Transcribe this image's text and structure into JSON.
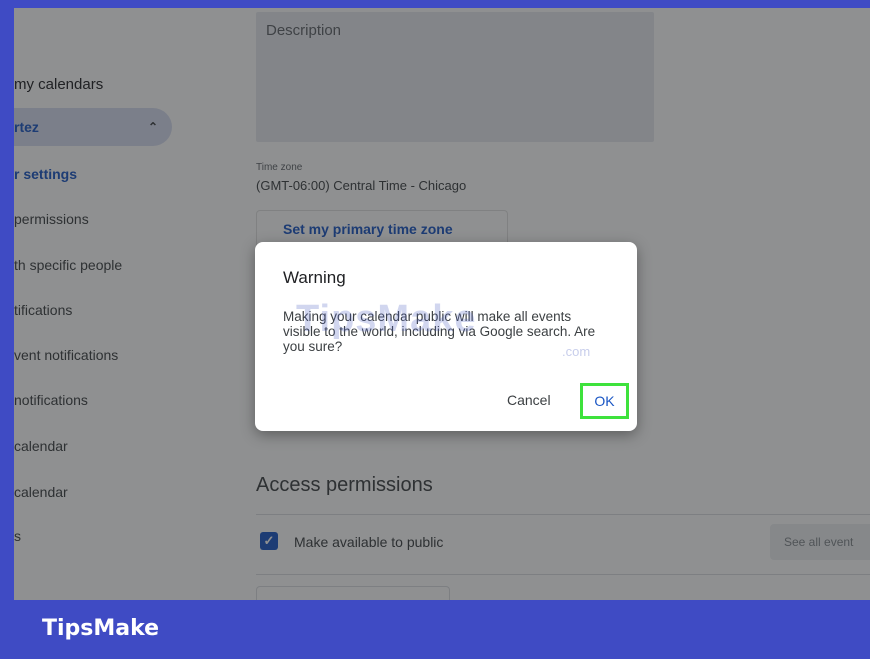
{
  "sidebar": {
    "items": [
      {
        "label": "my calendars",
        "kind": "header"
      },
      {
        "label": "rtez",
        "kind": "group"
      },
      {
        "label": "r settings",
        "kind": "selected"
      },
      {
        "label": "permissions",
        "kind": "normal"
      },
      {
        "label": "th specific people",
        "kind": "normal"
      },
      {
        "label": "tifications",
        "kind": "normal"
      },
      {
        "label": "vent notifications",
        "kind": "normal"
      },
      {
        "label": "notifications",
        "kind": "normal"
      },
      {
        "label": "calendar",
        "kind": "normal"
      },
      {
        "label": "calendar",
        "kind": "normal"
      },
      {
        "label": "s",
        "kind": "normal"
      }
    ]
  },
  "main": {
    "description_placeholder": "Description",
    "timezone_label": "Time zone",
    "timezone_value": "(GMT-06:00) Central Time - Chicago",
    "set_timezone_button": "Set my primary time zone",
    "access_title": "Access permissions",
    "make_public_label": "Make available to public",
    "make_public_checked": true,
    "see_all_label": "See all event"
  },
  "dialog": {
    "title": "Warning",
    "body": "Making your calendar public will make all events visible to the world, including via Google search. Are you sure?",
    "cancel_label": "Cancel",
    "ok_label": "OK"
  },
  "watermark": {
    "text": "TipsMake",
    "suffix": ".com"
  },
  "footer": {
    "brand": "TipsMake"
  },
  "colors": {
    "frame": "#3f4bc4",
    "accent": "#1a56c4",
    "highlight": "#3ee23c"
  }
}
